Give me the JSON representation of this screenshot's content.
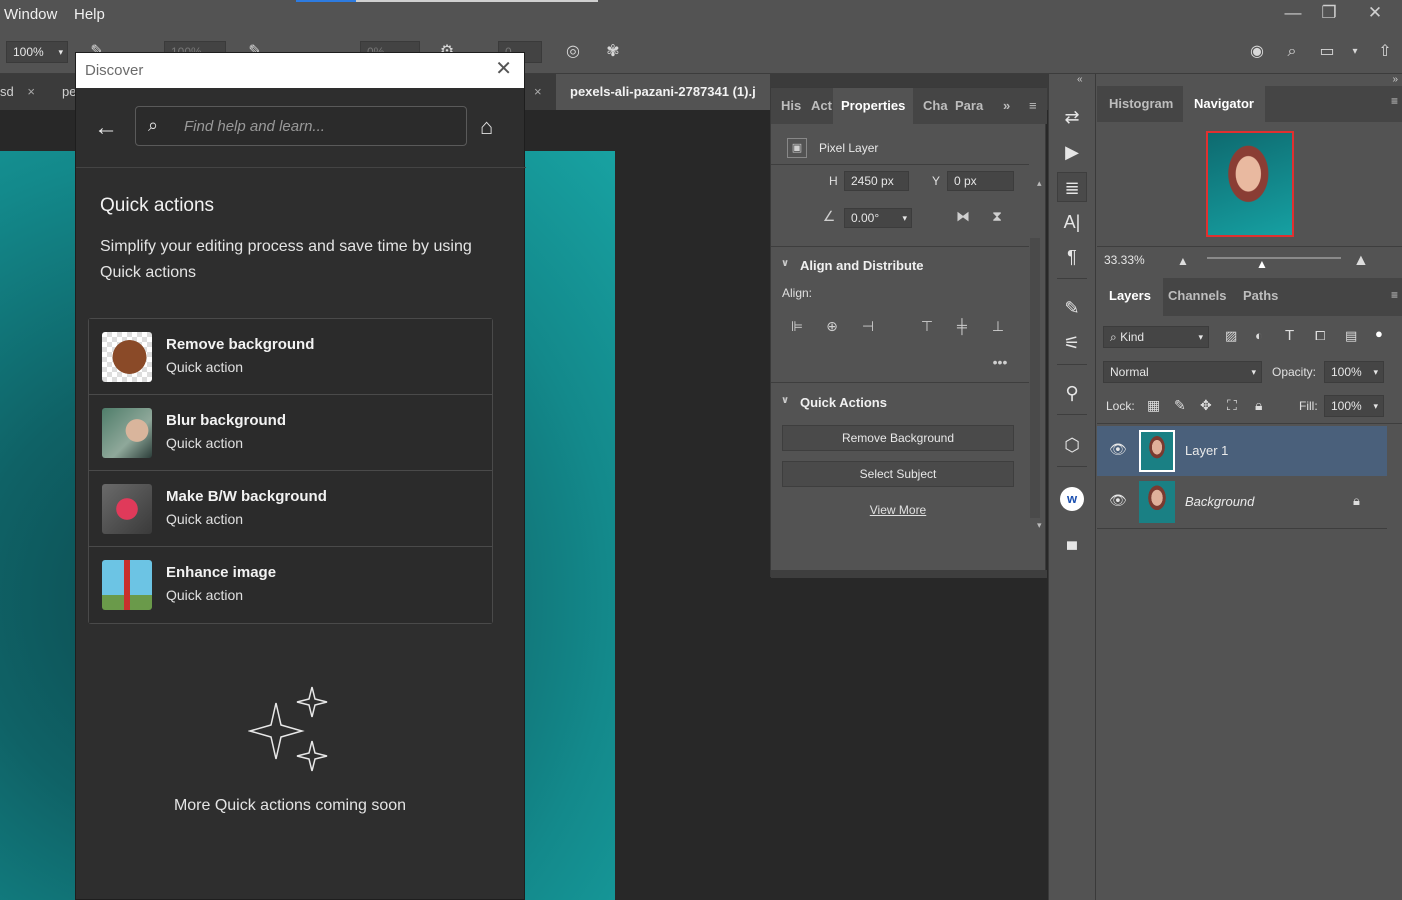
{
  "menubar": {
    "window": "Window",
    "help": "Help",
    "minimize": "—",
    "restore": "❐",
    "close": "✕"
  },
  "optionsbar": {
    "zoom": "100%",
    "field2": "100%",
    "field3": "0%",
    "field4": "0"
  },
  "tabs": {
    "tab1": "sd",
    "tab2": "pe",
    "tab3": "pexels-ali-pazani-2787341 (1).j"
  },
  "discover": {
    "title": "Discover",
    "search_placeholder": "Find help and learn...",
    "heading": "Quick actions",
    "description": "Simplify your editing process and save time by using Quick actions",
    "items": [
      {
        "name": "Remove background",
        "sub": "Quick action"
      },
      {
        "name": "Blur background",
        "sub": "Quick action"
      },
      {
        "name": "Make B/W background",
        "sub": "Quick action"
      },
      {
        "name": "Enhance image",
        "sub": "Quick action"
      }
    ],
    "coming_soon": "More Quick actions coming soon"
  },
  "properties": {
    "tabs": {
      "his": "His",
      "act": "Act",
      "properties": "Properties",
      "cha": "Cha",
      "para": "Para"
    },
    "layer_type": "Pixel Layer",
    "h_label": "H",
    "h_value": "2450 px",
    "y_label": "Y",
    "y_value": "0 px",
    "angle_value": "0.00°",
    "align_heading": "Align and Distribute",
    "align_label": "Align:",
    "qa_heading": "Quick Actions",
    "remove_bg_btn": "Remove Background",
    "select_subject_btn": "Select Subject",
    "view_more": "View More"
  },
  "navigator": {
    "tab_histogram": "Histogram",
    "tab_navigator": "Navigator",
    "zoom": "33.33%"
  },
  "layers": {
    "tab_layers": "Layers",
    "tab_channels": "Channels",
    "tab_paths": "Paths",
    "kind": "Kind",
    "blend_mode": "Normal",
    "opacity_label": "Opacity:",
    "opacity_value": "100%",
    "lock_label": "Lock:",
    "fill_label": "Fill:",
    "fill_value": "100%",
    "rows": [
      {
        "name": "Layer 1"
      },
      {
        "name": "Background"
      }
    ]
  },
  "colors": {
    "accent": "#2d7be0",
    "selected_layer": "#4a607b",
    "canvas_teal": "#13898b"
  }
}
